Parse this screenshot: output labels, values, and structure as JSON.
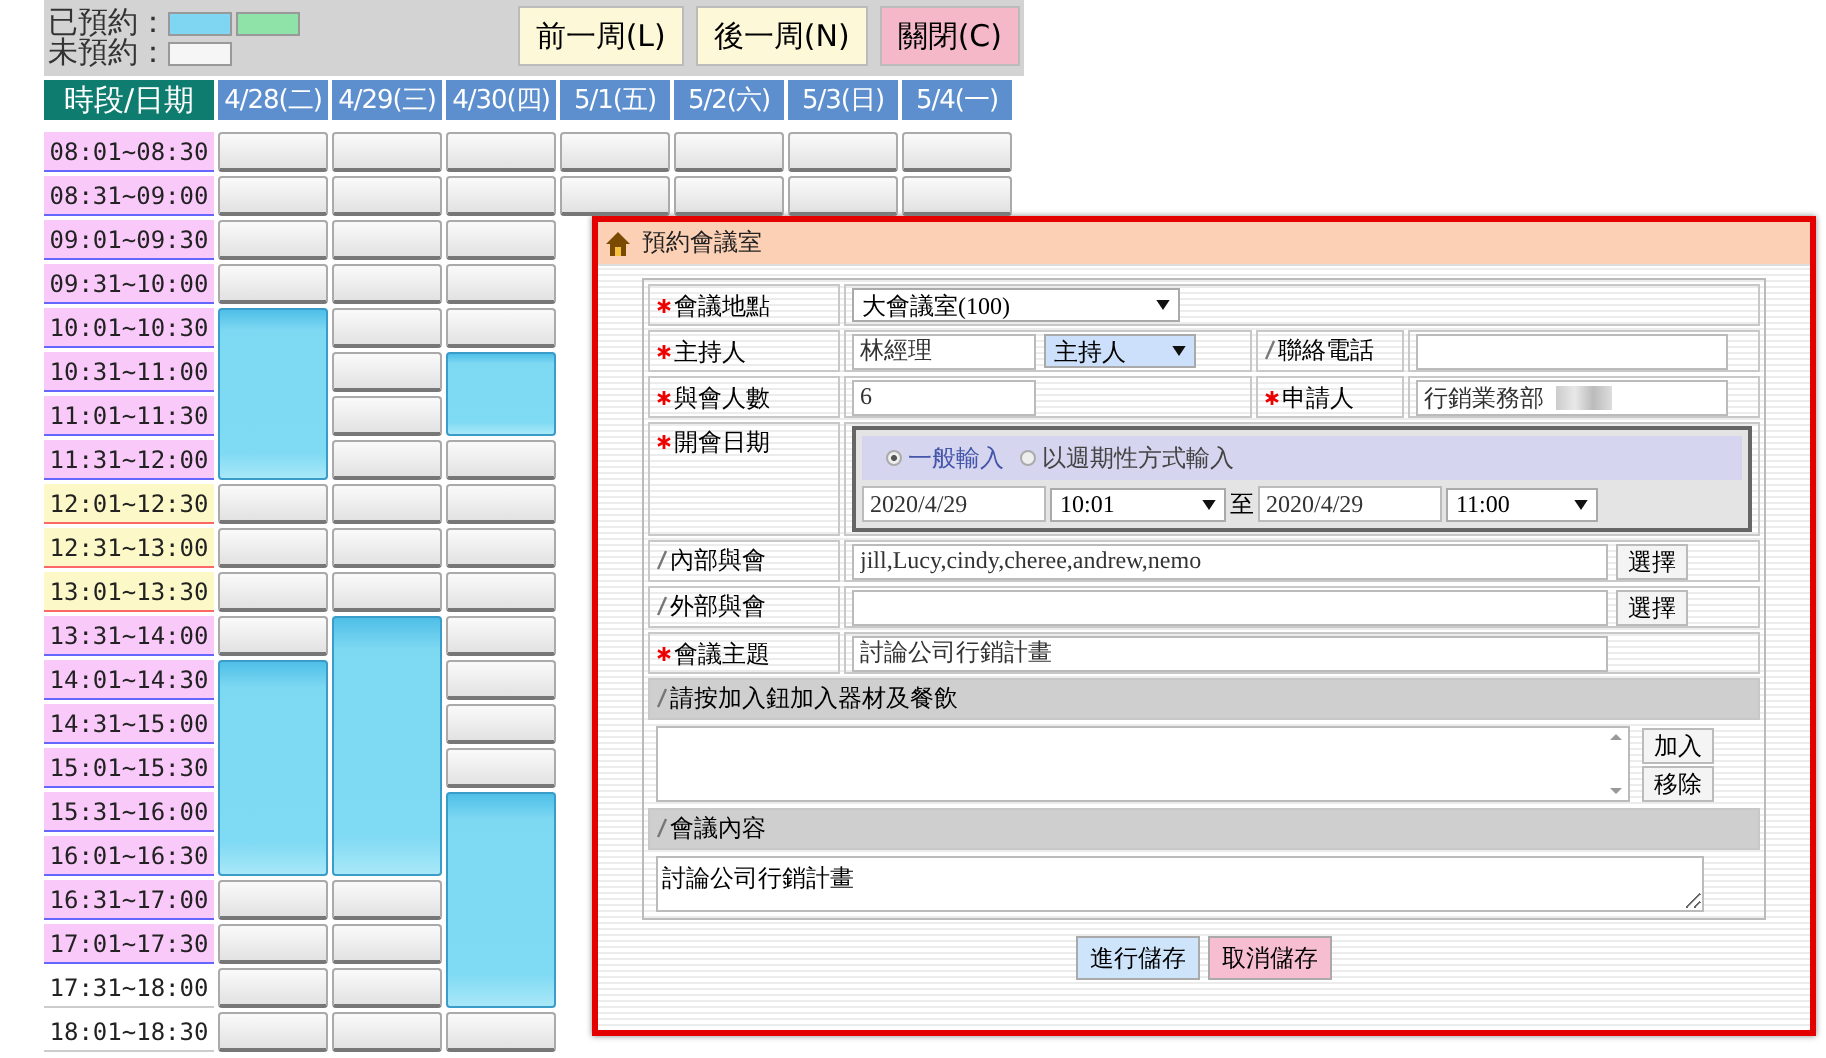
{
  "legend": [
    {
      "label": "已預約：",
      "swatches": [
        {
          "color": "#7fd6f2"
        },
        {
          "color": "#8fe3a8"
        }
      ]
    },
    {
      "label": "未預約：",
      "swatches": [
        {
          "color": "#f6f6f6"
        }
      ]
    }
  ],
  "nav_buttons": [
    {
      "label": "前一周(L)",
      "kind": "nav"
    },
    {
      "label": "後一周(N)",
      "kind": "nav"
    },
    {
      "label": "關閉(C)",
      "kind": "close"
    }
  ],
  "schedule": {
    "corner": "時段/日期",
    "times": [
      {
        "label": "08:01~08:30",
        "kind": "work"
      },
      {
        "label": "08:31~09:00",
        "kind": "work"
      },
      {
        "label": "09:01~09:30",
        "kind": "work"
      },
      {
        "label": "09:31~10:00",
        "kind": "work"
      },
      {
        "label": "10:01~10:30",
        "kind": "work"
      },
      {
        "label": "10:31~11:00",
        "kind": "work"
      },
      {
        "label": "11:01~11:30",
        "kind": "work"
      },
      {
        "label": "11:31~12:00",
        "kind": "work"
      },
      {
        "label": "12:01~12:30",
        "kind": "lunch"
      },
      {
        "label": "12:31~13:00",
        "kind": "lunch"
      },
      {
        "label": "13:01~13:30",
        "kind": "lunch"
      },
      {
        "label": "13:31~14:00",
        "kind": "work"
      },
      {
        "label": "14:01~14:30",
        "kind": "work"
      },
      {
        "label": "14:31~15:00",
        "kind": "work"
      },
      {
        "label": "15:01~15:30",
        "kind": "work"
      },
      {
        "label": "15:31~16:00",
        "kind": "work"
      },
      {
        "label": "16:01~16:30",
        "kind": "work"
      },
      {
        "label": "16:31~17:00",
        "kind": "work"
      },
      {
        "label": "17:01~17:30",
        "kind": "work"
      },
      {
        "label": "17:31~18:00",
        "kind": "off"
      },
      {
        "label": "18:01~18:30",
        "kind": "off"
      }
    ],
    "days": [
      {
        "label": "4/28(二)",
        "slots": [
          {
            "booked": false
          },
          {
            "booked": false
          },
          {
            "booked": false
          },
          {
            "booked": false
          },
          {
            "booked": true
          },
          {
            "booked": true
          },
          {
            "booked": true
          },
          {
            "booked": true
          },
          {
            "booked": false
          },
          {
            "booked": false
          },
          {
            "booked": false
          },
          {
            "booked": false
          },
          {
            "booked": true
          },
          {
            "booked": true
          },
          {
            "booked": true
          },
          {
            "booked": true
          },
          {
            "booked": true
          },
          {
            "booked": false
          },
          {
            "booked": false
          },
          {
            "booked": false
          },
          {
            "booked": false
          }
        ]
      },
      {
        "label": "4/29(三)",
        "slots": [
          {
            "booked": false
          },
          {
            "booked": false
          },
          {
            "booked": false
          },
          {
            "booked": false
          },
          {
            "booked": false
          },
          {
            "booked": false
          },
          {
            "booked": false
          },
          {
            "booked": false
          },
          {
            "booked": false
          },
          {
            "booked": false
          },
          {
            "booked": false
          },
          {
            "booked": true
          },
          {
            "booked": true
          },
          {
            "booked": true
          },
          {
            "booked": true
          },
          {
            "booked": true
          },
          {
            "booked": true
          },
          {
            "booked": false
          },
          {
            "booked": false
          },
          {
            "booked": false
          },
          {
            "booked": false
          }
        ]
      },
      {
        "label": "4/30(四)",
        "slots": [
          {
            "booked": false
          },
          {
            "booked": false
          },
          {
            "booked": false
          },
          {
            "booked": false
          },
          {
            "booked": false
          },
          {
            "booked": true
          },
          {
            "booked": true
          },
          {
            "booked": false
          },
          {
            "booked": false
          },
          {
            "booked": false
          },
          {
            "booked": false
          },
          {
            "booked": false
          },
          {
            "booked": false
          },
          {
            "booked": false
          },
          {
            "booked": false
          },
          {
            "booked": true
          },
          {
            "booked": true
          },
          {
            "booked": true
          },
          {
            "booked": true
          },
          {
            "booked": true
          },
          {
            "booked": false
          }
        ]
      },
      {
        "label": "5/1(五)",
        "slots": [
          {
            "booked": false
          },
          {
            "booked": false
          }
        ]
      },
      {
        "label": "5/2(六)",
        "slots": [
          {
            "booked": false
          },
          {
            "booked": false
          }
        ]
      },
      {
        "label": "5/3(日)",
        "slots": [
          {
            "booked": false
          },
          {
            "booked": false
          }
        ]
      },
      {
        "label": "5/4(一)",
        "slots": [
          {
            "booked": false
          },
          {
            "booked": false
          }
        ]
      }
    ]
  },
  "dialog": {
    "title": "預約會議室",
    "location": {
      "label": "會議地點",
      "required": true,
      "value": "大會議室(100)"
    },
    "host": {
      "label": "主持人",
      "required": true,
      "value": "林經理",
      "role": "主持人"
    },
    "phone": {
      "label": "聯絡電話",
      "required": false
    },
    "attendees": {
      "label": "與會人數",
      "required": true,
      "value": "6"
    },
    "applicant": {
      "label": "申請人",
      "required": true,
      "value": "行銷業務部",
      "redacted": true
    },
    "date": {
      "label": "開會日期",
      "required": true,
      "modes": [
        {
          "label": "一般輸入",
          "selected": true
        },
        {
          "label": "以週期性方式輸入",
          "selected": false
        }
      ],
      "start_date": "2020/4/29",
      "start_time": "10:01",
      "separator": "至",
      "end_date": "2020/4/29",
      "end_time": "11:00"
    },
    "internal": {
      "label": "內部與會",
      "required": false,
      "value": "jill,Lucy,cindy,cheree,andrew,nemo",
      "button": "選擇"
    },
    "external": {
      "label": "外部與會",
      "required": false,
      "button": "選擇"
    },
    "subject": {
      "label": "會議主題",
      "required": true,
      "value": "討論公司行銷計畫"
    },
    "equipment": {
      "label": "請按加入鈕加入器材及餐飲",
      "required": false,
      "buttons": [
        "加入",
        "移除"
      ]
    },
    "content": {
      "label": "會議內容",
      "required": false,
      "value": "討論公司行銷計畫"
    },
    "actions": [
      {
        "label": "進行儲存",
        "kind": "save"
      },
      {
        "label": "取消儲存",
        "kind": "cancel"
      }
    ]
  }
}
